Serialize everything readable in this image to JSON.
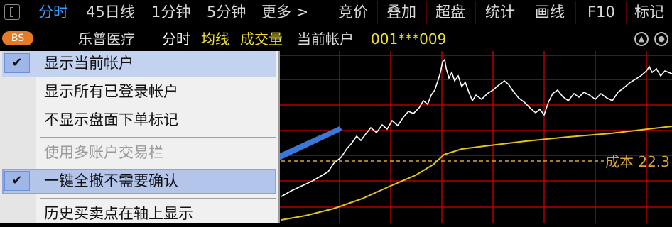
{
  "toolbar": {
    "tabs": [
      "分时",
      "45日线",
      "1分钟",
      "5分钟",
      "更多 >"
    ],
    "tools": [
      "竞价",
      "叠加",
      "超盘",
      "统计",
      "画线",
      "F10",
      "标记"
    ]
  },
  "info_bar": {
    "badge": "BS",
    "stock_name": "乐普医疗",
    "mode": "分时",
    "avg_line": "均线",
    "volume": "成交量",
    "account_label": "当前帐户",
    "account_id": "001***009"
  },
  "chart": {
    "cost_label": "成本 22.3",
    "price_color": "#ffffff",
    "avg_color": "#e6c21c",
    "grid_color": "#b40000",
    "cost_line_color": "#d9a53a"
  },
  "menu": {
    "items": [
      {
        "label": "显示当前帐户",
        "checked": true,
        "disabled": false
      },
      {
        "label": "显示所有已登录帐户",
        "checked": false,
        "disabled": false
      },
      {
        "label": "不显示盘面下单标记",
        "checked": false,
        "disabled": false
      },
      {
        "label": "使用多账户交易栏",
        "checked": false,
        "disabled": true
      },
      {
        "label": "一键全撤不需要确认",
        "checked": true,
        "disabled": false
      },
      {
        "label": "历史买卖点在轴上显示",
        "checked": false,
        "disabled": false
      }
    ],
    "check_glyph": "✔"
  },
  "annotation": {
    "arrow_color": "#3a78d8"
  }
}
